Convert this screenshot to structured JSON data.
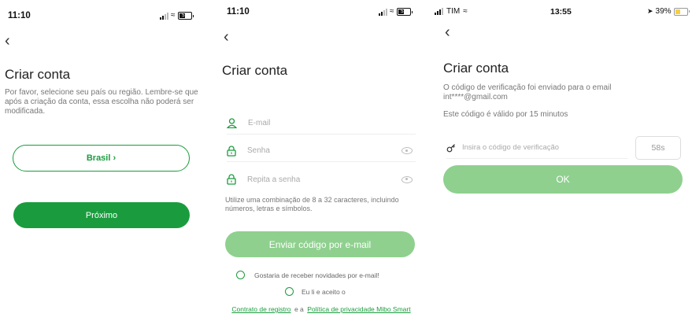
{
  "colors": {
    "brand_green": "#1a9c3e",
    "muted_green": "#8fd08f",
    "battery_yellow": "#f4d03f"
  },
  "screen1": {
    "status": {
      "time": "11:10",
      "battery": "51"
    },
    "back_icon": "chevron-left-icon",
    "title": "Criar conta",
    "description": "Por favor, selecione seu país ou região. Lembre-se que após a criação da conta, essa escolha não poderá ser modificada.",
    "country_button": "Brasil ›",
    "next_button": "Próximo"
  },
  "screen2": {
    "status": {
      "time": "11:10",
      "battery": "51"
    },
    "title": "Criar conta",
    "email_placeholder": "E-mail",
    "password_placeholder": "Senha",
    "repeat_password_placeholder": "Repita a senha",
    "password_hint": "Utilize uma combinação de 8 a 32 caracteres, incluindo números, letras e símbolos.",
    "send_code_button": "Enviar código por e-mail",
    "newsletter_option": "Gostaria de receber novidades por e-mail!",
    "accept_option": "Eu li e aceito o",
    "contract_link": "Contrato de registro",
    "conjunction": "e a",
    "privacy_link": "Política de privacidade Mibo Smart"
  },
  "screen3": {
    "status": {
      "carrier": "TIM",
      "time": "13:55",
      "battery": "39%"
    },
    "title": "Criar conta",
    "sent_message": "O código de verificação foi enviado para o email int****@gmail.com",
    "validity": "Este código é válido por 15 minutos",
    "code_placeholder": "Insira o código de verificação",
    "countdown": "58s",
    "ok_button": "OK"
  }
}
